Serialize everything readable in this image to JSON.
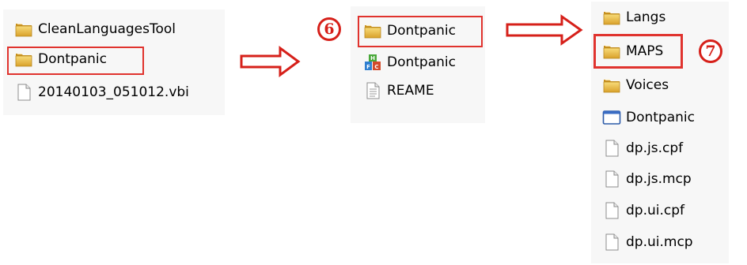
{
  "panel_1": {
    "items": [
      {
        "label": "CleanLanguagesTool",
        "icon": "folder-icon"
      },
      {
        "label": "Dontpanic",
        "icon": "folder-icon"
      },
      {
        "label": "20140103_051012.vbi",
        "icon": "file-icon"
      }
    ]
  },
  "panel_2": {
    "step_badge": "6",
    "items": [
      {
        "label": "Dontpanic",
        "icon": "folder-icon"
      },
      {
        "label": "Dontpanic",
        "icon": "app-icon"
      },
      {
        "label": "REAME",
        "icon": "text-file-icon"
      }
    ]
  },
  "panel_3": {
    "step_badge": "7",
    "items": [
      {
        "label": "Langs",
        "icon": "folder-icon"
      },
      {
        "label": "MAPS",
        "icon": "folder-icon"
      },
      {
        "label": "Voices",
        "icon": "folder-icon"
      },
      {
        "label": "Dontpanic",
        "icon": "window-icon"
      },
      {
        "label": "dp.js.cpf",
        "icon": "file-icon"
      },
      {
        "label": "dp.js.mcp",
        "icon": "file-icon"
      },
      {
        "label": "dp.ui.cpf",
        "icon": "file-icon"
      },
      {
        "label": "dp.ui.mcp",
        "icon": "file-icon"
      }
    ]
  },
  "colors": {
    "highlight": "#e0332e",
    "arrow": "#d6201a",
    "folder": "#e8b93a"
  }
}
